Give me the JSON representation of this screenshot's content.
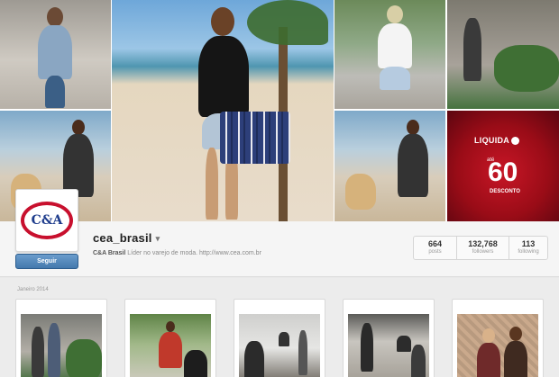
{
  "cover": {
    "promo": {
      "liquida": "LIQUIDA",
      "ate": "até",
      "percent": "60",
      "desconto": "DESCONTO"
    }
  },
  "profile": {
    "avatar_logo": "C&A",
    "follow_label": "Seguir",
    "username": "cea_brasil",
    "username_caret": "▾",
    "bio_name": "C&A Brasil",
    "bio_text": "Líder no varejo de moda. http://www.cea.com.br",
    "stats": [
      {
        "value": "664",
        "label": "posts"
      },
      {
        "value": "132,768",
        "label": "followers"
      },
      {
        "value": "113",
        "label": "following"
      }
    ]
  },
  "feed": {
    "month_label": "Janeiro 2014"
  },
  "colors": {
    "brand_red": "#c8102e",
    "brand_blue": "#1e3c8c",
    "follow_button": "#4a7fb3"
  }
}
